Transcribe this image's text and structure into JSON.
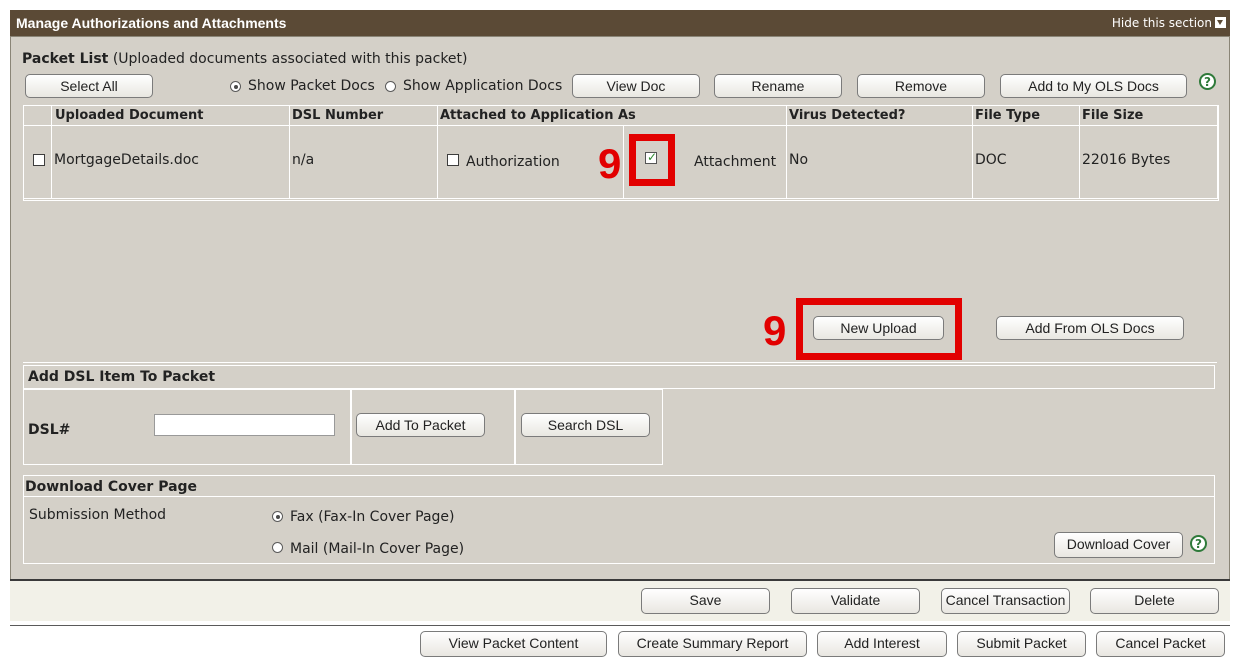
{
  "section": {
    "title": "Manage Authorizations and Attachments",
    "hide_label": "Hide this section"
  },
  "packet_list": {
    "heading": "Packet List",
    "subheading": "(Uploaded documents associated with this packet)",
    "select_all": "Select All",
    "radio_packet_docs": "Show Packet Docs",
    "radio_application_docs": "Show Application Docs",
    "view_doc": "View Doc",
    "rename": "Rename",
    "remove": "Remove",
    "add_to_my_ols": "Add to My OLS Docs",
    "help": "?",
    "columns": [
      "Uploaded Document",
      "DSL Number",
      "Attached to Application As",
      "Virus Detected?",
      "File Type",
      "File Size"
    ],
    "rows": [
      {
        "document": "MortgageDetails.doc",
        "dsl_number": "n/a",
        "authorization_label": "Authorization",
        "attachment_label": "Attachment",
        "virus": "No",
        "file_type": "DOC",
        "file_size": "22016 Bytes"
      }
    ],
    "new_upload": "New Upload",
    "add_from_ols": "Add From OLS Docs"
  },
  "annotations": {
    "step_checkbox": "9",
    "step_upload": "9"
  },
  "dsl": {
    "heading": "Add DSL Item To Packet",
    "field_label": "DSL#",
    "field_value": "",
    "add_to_packet": "Add To Packet",
    "search_dsl": "Search DSL"
  },
  "cover": {
    "heading": "Download Cover Page",
    "method_label": "Submission Method",
    "fax_label": "Fax (Fax-In Cover Page)",
    "mail_label": "Mail (Mail-In Cover Page)",
    "download": "Download Cover",
    "help": "?"
  },
  "footer": {
    "row1": [
      "Save",
      "Validate",
      "Cancel Transaction",
      "Delete"
    ],
    "row2": [
      "View Packet Content",
      "Create Summary Report",
      "Add Interest",
      "Submit Packet",
      "Cancel Packet"
    ]
  },
  "colors": {
    "title_bar": "#5b4a36",
    "panel": "#d4d0c8",
    "annotation": "#e20000",
    "help": "#2f7a3a"
  }
}
